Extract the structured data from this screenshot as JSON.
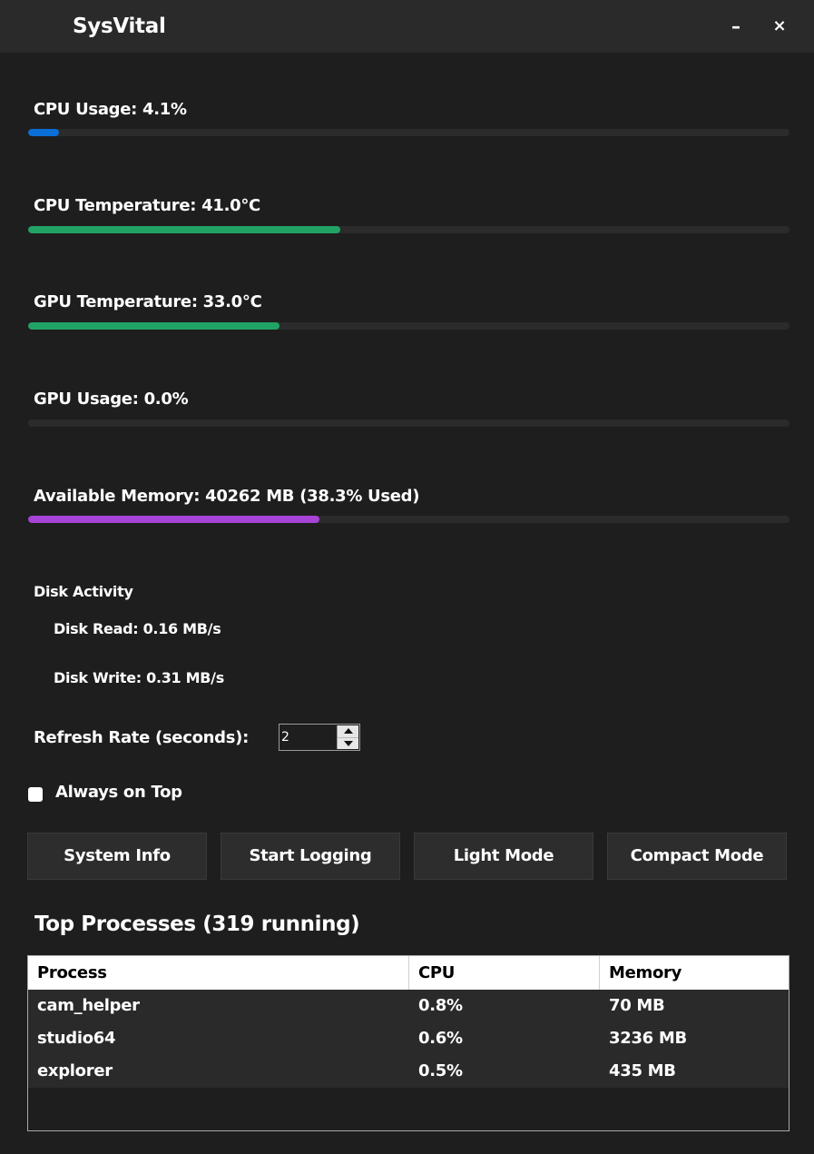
{
  "window": {
    "title": "SysVital",
    "minimize_label": "–",
    "close_label": "×"
  },
  "metrics": [
    {
      "label": "CPU Usage: 4.1%",
      "fill_fraction": 0.041,
      "color": "#0a6fd6"
    },
    {
      "label": "CPU Temperature: 41.0°C",
      "fill_fraction": 0.41,
      "color": "#21a366"
    },
    {
      "label": "GPU Temperature: 33.0°C",
      "fill_fraction": 0.33,
      "color": "#21a366"
    },
    {
      "label": "GPU Usage: 0.0%",
      "fill_fraction": 0.0,
      "color": "#0a6fd6"
    },
    {
      "label": "Available Memory: 40262 MB (38.3% Used)",
      "fill_fraction": 0.383,
      "color": "#a743d6"
    }
  ],
  "disk": {
    "title": "Disk Activity",
    "read": "Disk Read: 0.16 MB/s",
    "write": "Disk Write: 0.31 MB/s"
  },
  "refresh": {
    "label": "Refresh Rate (seconds):",
    "value": "2"
  },
  "always_on_top": {
    "label": "Always on Top",
    "checked": false
  },
  "buttons": {
    "system_info": "System Info",
    "start_logging": "Start Logging",
    "light_mode": "Light Mode",
    "compact_mode": "Compact Mode"
  },
  "processes": {
    "heading": "Top Processes (319 running)",
    "columns": [
      "Process",
      "CPU",
      "Memory"
    ],
    "rows": [
      {
        "name": "cam_helper",
        "cpu": "0.8%",
        "memory": "70 MB"
      },
      {
        "name": "studio64",
        "cpu": "0.6%",
        "memory": "3236 MB"
      },
      {
        "name": "explorer",
        "cpu": "0.5%",
        "memory": "435 MB"
      }
    ]
  }
}
